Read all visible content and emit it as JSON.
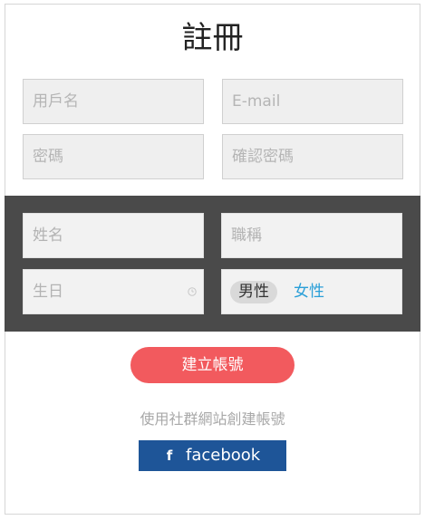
{
  "page": {
    "title": "註冊"
  },
  "form": {
    "username_placeholder": "用戶名",
    "email_placeholder": "E-mail",
    "password_placeholder": "密碼",
    "confirm_password_placeholder": "確認密碼",
    "name_placeholder": "姓名",
    "job_title_placeholder": "職稱",
    "birthday_placeholder": "生日",
    "birthday_icon": "clock-icon",
    "gender": {
      "options": [
        "男性",
        "女性"
      ],
      "selected": "男性"
    }
  },
  "actions": {
    "create_account_label": "建立帳號"
  },
  "social": {
    "prompt": "使用社群網站創建帳號",
    "facebook_icon_text": "f",
    "facebook_label": "facebook"
  },
  "colors": {
    "primary_button": "#f25a5e",
    "facebook": "#1e5598",
    "dark_section": "#4a4a4a",
    "gender_female": "#2a9fd8"
  }
}
